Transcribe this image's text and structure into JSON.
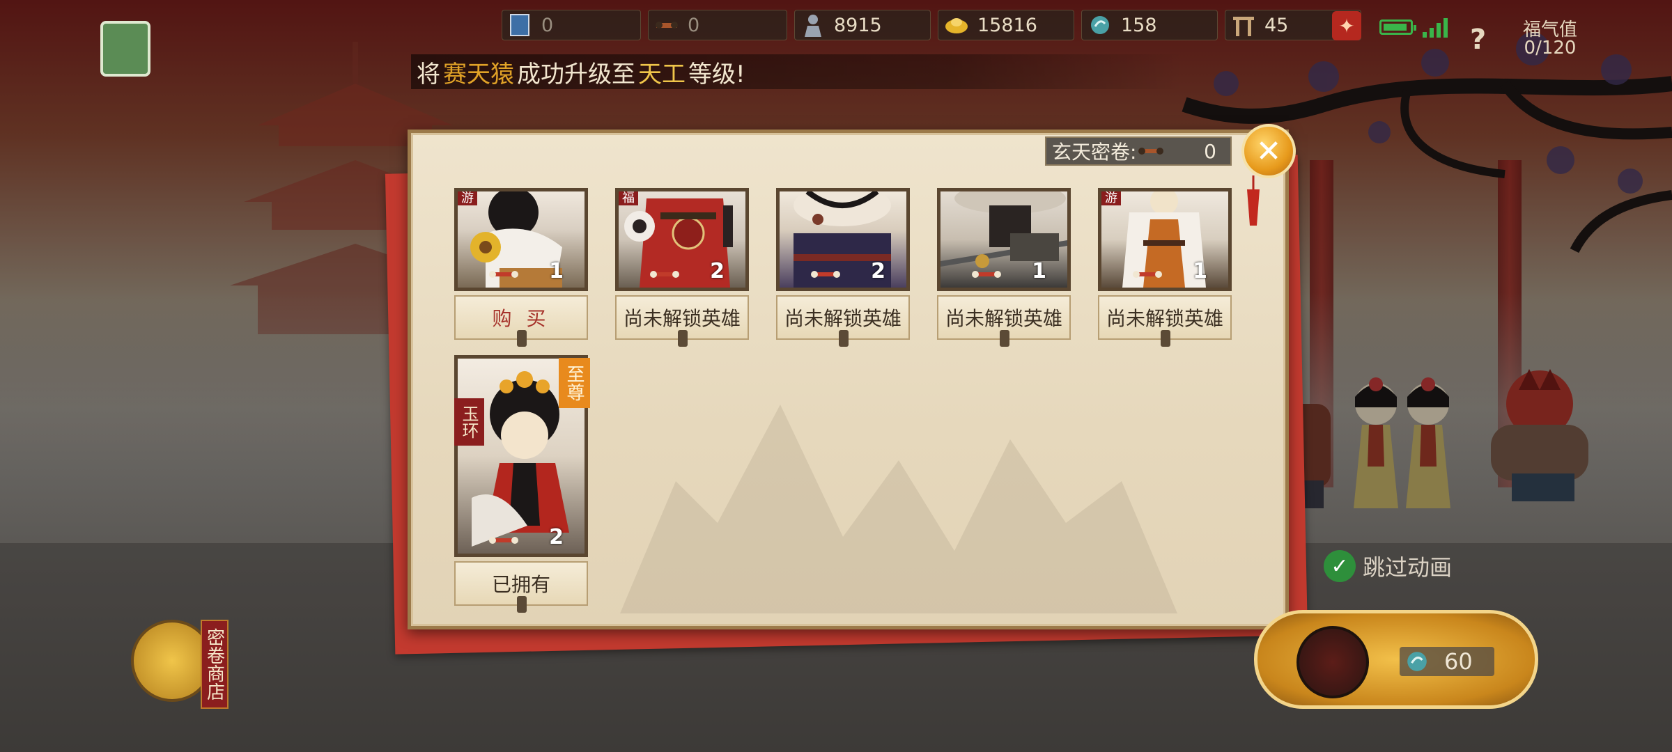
{
  "resources": [
    {
      "icon": "book-icon",
      "value": "0"
    },
    {
      "icon": "scroll-icon",
      "value": "0"
    },
    {
      "icon": "soldier-icon",
      "value": "8915"
    },
    {
      "icon": "gold-ingot-icon",
      "value": "15816"
    },
    {
      "icon": "jade-icon",
      "value": "158"
    },
    {
      "icon": "gate-icon",
      "value": "45"
    }
  ],
  "fortune": {
    "label": "福气值",
    "value": "0/120"
  },
  "announcement": {
    "prefix": "将",
    "hero": "赛天猿",
    "middle": "成功升级至",
    "rank": "天工",
    "suffix": "等级!"
  },
  "dialog": {
    "scroll_label": "玄天密卷:",
    "scroll_count": "0",
    "cards": [
      {
        "count": "1",
        "button": "购 买",
        "ribbon": "游"
      },
      {
        "count": "2",
        "button": "尚未解锁英雄",
        "ribbon": "福"
      },
      {
        "count": "2",
        "button": "尚未解锁英雄",
        "ribbon": ""
      },
      {
        "count": "1",
        "button": "尚未解锁英雄",
        "ribbon": ""
      },
      {
        "count": "1",
        "button": "尚未解锁英雄",
        "ribbon": "游"
      }
    ],
    "featured": {
      "count": "2",
      "button": "已拥有",
      "name": "玉环",
      "rank": "至尊"
    }
  },
  "shop_label": "密卷商店",
  "skip_label": "跳过动画",
  "summon_cost": "60",
  "colors": {
    "accent": "#e79a1c",
    "banner_red": "#8b1e1e",
    "skip_green": "#2e8f3b"
  }
}
